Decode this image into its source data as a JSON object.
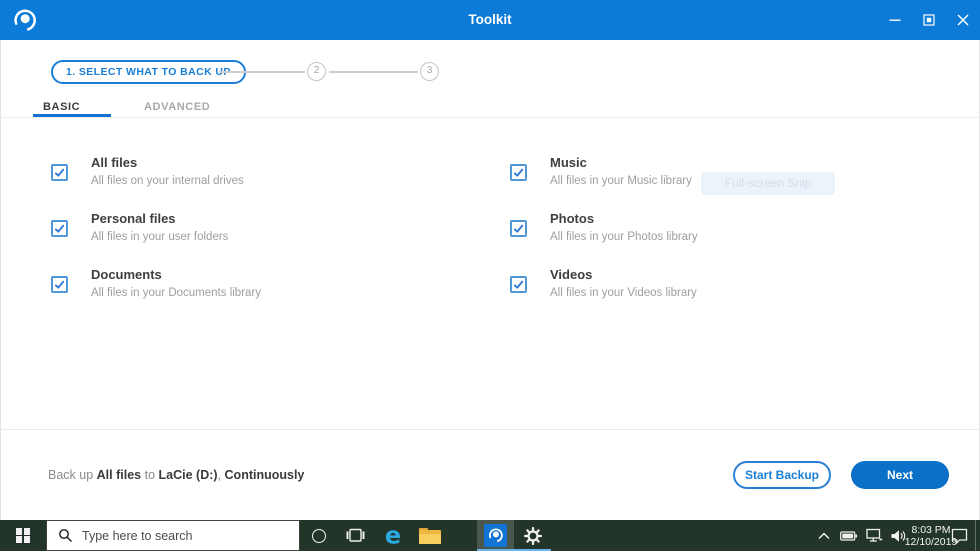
{
  "window": {
    "title": "Toolkit",
    "controls": {
      "minimize": "minimize",
      "maximize": "maximize",
      "close": "close"
    }
  },
  "stepper": {
    "step1_label": "1. SELECT WHAT TO BACK UP",
    "step2_label": "2",
    "step3_label": "3"
  },
  "tabs": {
    "basic_label": "BASIC",
    "advanced_label": "ADVANCED"
  },
  "backup_items": [
    {
      "title": "All files",
      "description": "All files on your internal drives",
      "checked": true
    },
    {
      "title": "Personal files",
      "description": "All files in your user folders",
      "checked": true
    },
    {
      "title": "Documents",
      "description": "All files in your Documents library",
      "checked": true
    },
    {
      "title": "Music",
      "description": "All files in your Music library",
      "checked": true
    },
    {
      "title": "Photos",
      "description": "All files in your Photos library",
      "checked": true
    },
    {
      "title": "Videos",
      "description": "All files in your Videos library",
      "checked": true
    }
  ],
  "ghost_tooltip": {
    "label": "Full-screen Snip"
  },
  "footer": {
    "summary": {
      "prefix": "Back up",
      "selection": "All files",
      "to_word": "to",
      "target": "LaCie (D:)",
      "separator": ",",
      "frequency": "Continuously"
    },
    "start_backup_label": "Start Backup",
    "next_label": "Next"
  },
  "taskbar": {
    "search_placeholder": "Type here to search",
    "clock": {
      "time": "8:03 PM",
      "date": "12/10/2019"
    }
  },
  "colors": {
    "titlebar_blue": "#0c7bd8",
    "accent_blue": "#1a7fd4",
    "tab_underline": "#1673d1",
    "checkbox_blue": "#4f97d6",
    "next_button_bg": "#0b70c8",
    "taskbar_bg": "#233428",
    "taskbar_active_underline": "#69b3e8"
  }
}
